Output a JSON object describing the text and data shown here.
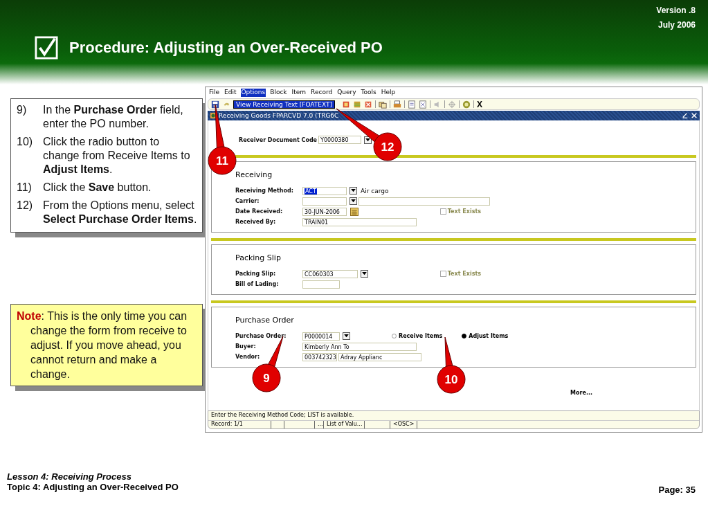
{
  "header": {
    "title": "Procedure:  Adjusting an Over-Received PO",
    "version": "Version .8",
    "date": "July  2006"
  },
  "instructions": [
    {
      "number": "9)",
      "text": "In the **Purchase Order** field, enter the PO number."
    },
    {
      "number": "10)",
      "text": "Click the radio button to change from Receive Items to **Adjust Items**."
    },
    {
      "number": "11)",
      "text": "Click the **Save** button."
    },
    {
      "number": "12)",
      "text": "From the Options menu, select **Select Purchase Order Items**."
    }
  ],
  "note": {
    "label": "Note",
    "text": ": This is the only time you can change the form from receive to adjust.  If you move ahead, you cannot return and make a change."
  },
  "app": {
    "menu": [
      {
        "label": "File",
        "selected": false
      },
      {
        "label": "Edit",
        "selected": false
      },
      {
        "label": "Options",
        "selected": true
      },
      {
        "label": "Block",
        "selected": false
      },
      {
        "label": "Item",
        "selected": false
      },
      {
        "label": "Record",
        "selected": false
      },
      {
        "label": "Query",
        "selected": false
      },
      {
        "label": "Tools",
        "selected": false
      },
      {
        "label": "Help",
        "selected": false
      }
    ],
    "menu_item": "View Receiving Text [FOATEXT]",
    "exit_label": "X",
    "window_title": "Receiving Goods  FPARCVD  7.0  (TRG6C",
    "key": {
      "label": "Receiver Document Code",
      "value": "Y0000380"
    },
    "sections": [
      {
        "title": "Receiving",
        "rows": [
          {
            "label": "Receiving Method:",
            "kind": "dropdown",
            "value": "ACT",
            "highlighted": true,
            "description": "Air cargo"
          },
          {
            "label": "Carrier:",
            "kind": "dropdown_field",
            "value": ""
          },
          {
            "label": "Date Received:",
            "kind": "date",
            "value": "30-JUN-2006",
            "checkbox": {
              "label": "Text Exists",
              "checked": false
            }
          },
          {
            "label": "Received By:",
            "kind": "input",
            "value": "TRAIN01"
          }
        ]
      },
      {
        "title": "Packing Slip",
        "rows": [
          {
            "label": "Packing Slip:",
            "kind": "dropdown",
            "value": "CC060303",
            "highlighted": false,
            "checkbox": {
              "label": "Text Exists",
              "checked": false
            }
          },
          {
            "label": "Bill of Lading:",
            "kind": "input",
            "value": ""
          }
        ]
      },
      {
        "title": "Purchase Order",
        "rows": [
          {
            "label": "Purchase Order:",
            "kind": "dropdown",
            "value": "P0000014",
            "highlighted": false,
            "radios": [
              {
                "label": "Receive Items",
                "selected": false
              },
              {
                "label": "Adjust Items",
                "selected": true
              }
            ]
          },
          {
            "label": "Buyer:",
            "kind": "input",
            "value": "Kimberly Ann  To"
          },
          {
            "label": "Vendor:",
            "kind": "pair",
            "value": "003742323",
            "value2": "Adray Applianc"
          }
        ]
      }
    ],
    "more": "More...",
    "status_message": "Enter the Receiving Method Code; LIST is available.",
    "status_cells": [
      "Record: 1/1",
      "",
      "",
      "...",
      "List of Valu...",
      "",
      "<OSC>"
    ]
  },
  "callouts": [
    "11",
    "12",
    "9",
    "10"
  ],
  "footer": {
    "lesson": "Lesson 4: Receiving Process",
    "topic": "Topic 4: Adjusting an Over-Received PO",
    "page": "Page: 35"
  }
}
